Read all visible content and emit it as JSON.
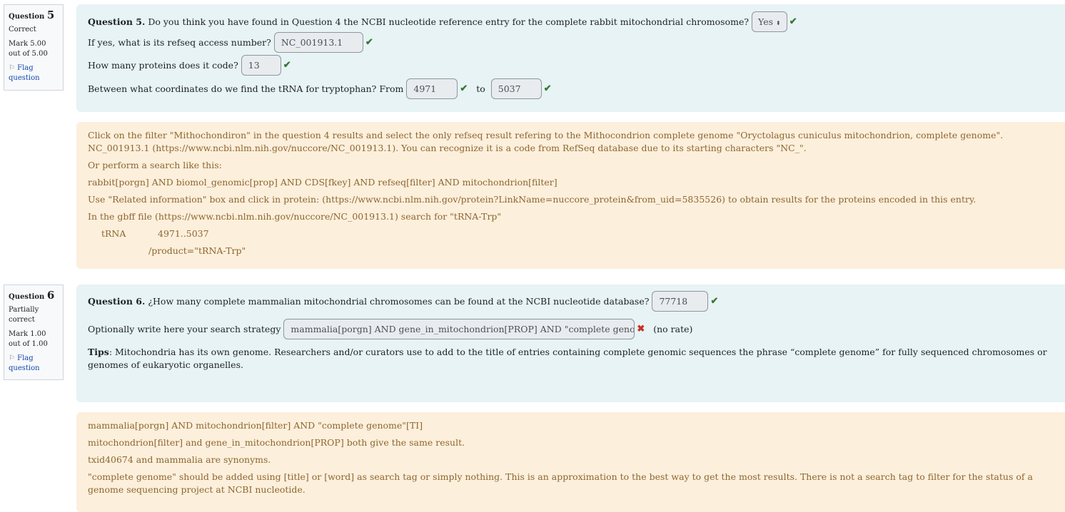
{
  "q5": {
    "info": {
      "label": "Question",
      "num": "5",
      "status": "Correct",
      "mark": "Mark 5.00 out of 5.00",
      "flag": "Flag question"
    },
    "title": "Question 5.",
    "text1": "Do you think you have found in Question 4 the NCBI nucleotide reference entry for the complete rabbit mitochondrial chromosome?",
    "select": "Yes",
    "text2": "If yes, what is its refseq access number?",
    "refseq": "NC_001913.1",
    "text3": "How many proteins does it code?",
    "proteins": "13",
    "text4": "Between what coordinates do we find the tRNA for tryptophan? From",
    "from": "4971",
    "to_label": "to",
    "to": "5037",
    "feedback": [
      "Click on the filter \"Mithochondiron\" in the question 4 results and select the only refseq result refering to the  Mithocondrion complete genome \"Oryctolagus cuniculus mitochondrion, complete genome\". NC_001913.1 (https://www.ncbi.nlm.nih.gov/nuccore/NC_001913.1). You can recognize it is a code from RefSeq database due to its starting characters \"NC_\".",
      "Or perform a search like this:",
      "rabbit[porgn] AND biomol_genomic[prop] AND CDS[fkey] AND refseq[filter] AND mitochondrion[filter]",
      "Use \"Related information\" box and click in protein: (https://www.ncbi.nlm.nih.gov/protein?LinkName=nuccore_protein&from_uid=5835526) to obtain results for the proteins encoded in this entry.",
      "In the gbff file (https://www.ncbi.nlm.nih.gov/nuccore/NC_001913.1) search for \"tRNA-Trp\""
    ],
    "gb_feature": "tRNA",
    "gb_range": "4971..5037",
    "gb_product": "/product=\"tRNA-Trp\""
  },
  "q6": {
    "info": {
      "label": "Question",
      "num": "6",
      "status": "Partially correct",
      "mark": "Mark 1.00 out of 1.00",
      "flag": "Flag question"
    },
    "title": "Question 6.",
    "text1": "¿How many complete mammalian mitochondrial chromosomes can be found at the NCBI nucleotide database?",
    "answer": "77718",
    "text2": "Optionally write here your search strategy",
    "strategy": "mammalia[porgn] AND gene_in_mitochondrion[PROP] AND \"complete genom",
    "norate": "(no rate)",
    "tips_label": "Tips",
    "tips": ": Mitochondria has its own genome. Researchers and/or curators use to add to the title of entries containing complete genomic sequences the phrase “complete genome” for fully sequenced chromosomes or genomes of eukaryotic organelles.",
    "feedback": [
      "mammalia[porgn] AND mitochondrion[filter] AND \"complete genome\"[TI]",
      "mitochondrion[filter] and gene_in_mitochondrion[PROP] both give the same result.",
      "txid40674 and mammalia are synonyms.",
      "\"complete genome\" should be added using [title] or [word] as search tag or simply nothing. This is an approximation to the best way to get the most results. There is not a search tag to filter for the status of a genome sequencing project at NCBI nucleotide."
    ]
  },
  "colors": {
    "correct": "#357a32",
    "incorrect": "#ca3120",
    "flag_link": "#0f47ad"
  }
}
